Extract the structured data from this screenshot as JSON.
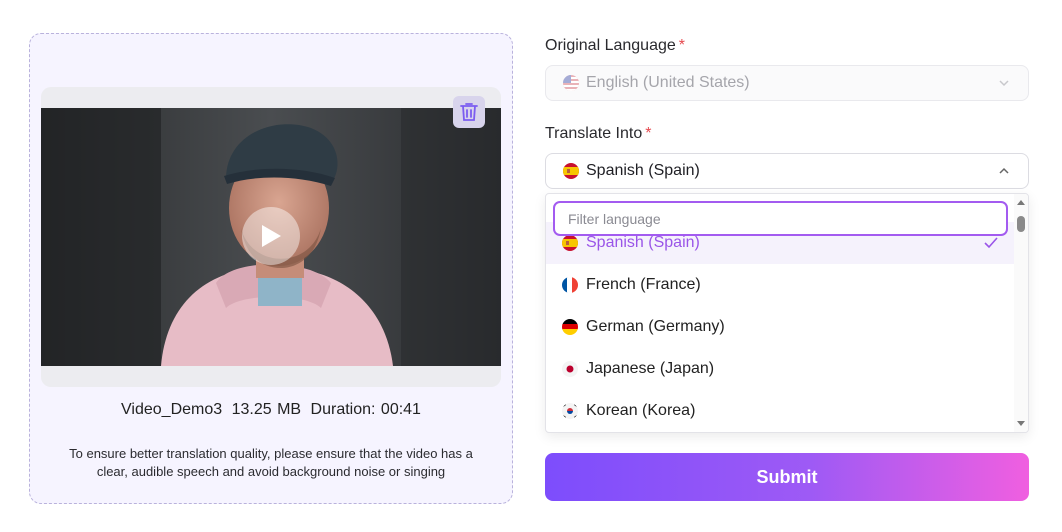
{
  "video": {
    "file_name": "Video_Demo3",
    "file_size": "13.25 MB",
    "duration": "Duration: 00:41",
    "hint": "To ensure better translation quality, please ensure that the video has a clear, audible speech and avoid background noise or singing"
  },
  "original_language": {
    "label": "Original Language",
    "required_mark": "*",
    "value": "English (United States)",
    "flag": "us-flag-icon"
  },
  "translate_into": {
    "label": "Translate Into",
    "required_mark": "*",
    "value": "Spanish (Spain)",
    "flag": "spain-flag-icon",
    "filter_placeholder": "Filter language",
    "options": [
      {
        "label": "Spanish (Spain)",
        "flag": "spain-flag-icon",
        "selected": true
      },
      {
        "label": "French (France)",
        "flag": "france-flag-icon",
        "selected": false
      },
      {
        "label": "German (Germany)",
        "flag": "germany-flag-icon",
        "selected": false
      },
      {
        "label": "Japanese (Japan)",
        "flag": "japan-flag-icon",
        "selected": false
      },
      {
        "label": "Korean (Korea)",
        "flag": "korea-flag-icon",
        "selected": false
      }
    ]
  },
  "submit": {
    "label": "Submit"
  },
  "colors": {
    "accent_purple": "#a35bf0",
    "required_red": "#e5484d",
    "submit_gradient_start": "#7d4dfc",
    "submit_gradient_end": "#f05fe0"
  }
}
